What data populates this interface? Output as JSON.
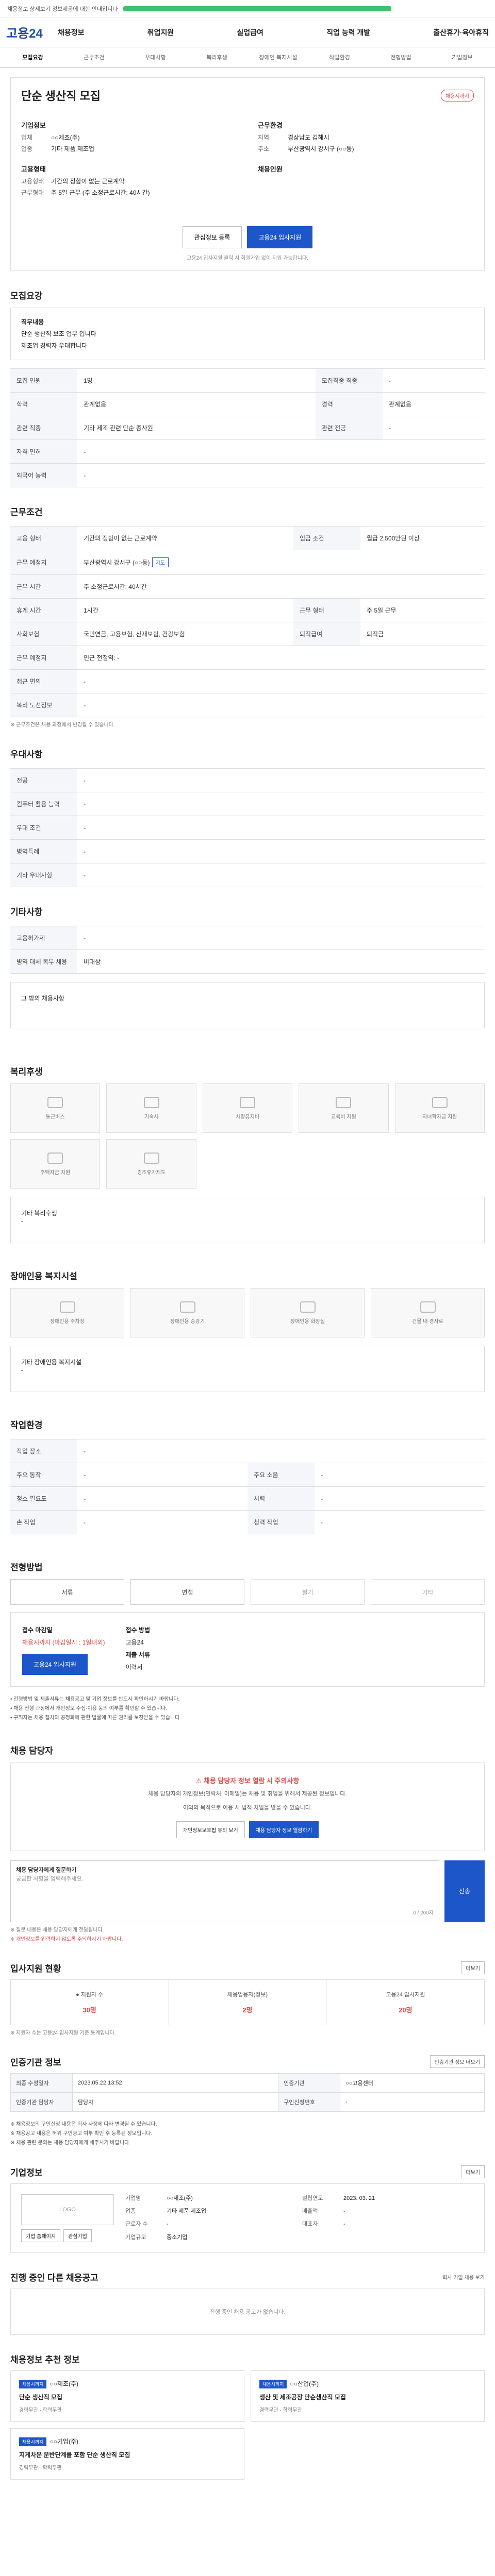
{
  "topbar": {
    "notice": "채용정보 상세보기 정보제공에 대한 안내입니다"
  },
  "gnb": {
    "logo": "고용24",
    "menu": [
      "채용정보",
      "취업지원",
      "실업급여",
      "직업 능력 개발",
      "출산휴가·육아휴직"
    ]
  },
  "anchor_tabs": [
    "모집요강",
    "근무조건",
    "우대사항",
    "복리후생",
    "장애인 복지시설",
    "작업환경",
    "전형방법",
    "기업정보"
  ],
  "job": {
    "title": "단순 생산직 모집",
    "badge": "채용시까지",
    "company_label": "기업정보",
    "company_name_k": "업체",
    "company_name_v": "○○제조(주)",
    "industry_k": "업종",
    "industry_v": "기타 제품 제조업",
    "workplace_label": "근무환경",
    "location_k": "지역",
    "location_v": "경상남도 김해시",
    "address_k": "주소",
    "address_v": "부산광역시 강서구 (○○동)",
    "type_label": "고용형태",
    "employ_k": "고용형태",
    "employ_v": "기간의 정함이 없는 근로계약",
    "hours_k": "근무형태",
    "hours_v": "주 5일 근무 (주 소정근로시간: 40시간)",
    "pay_label": "채용인원",
    "scrap_btn": "관심정보 등록",
    "apply_btn": "고용24 입사지원",
    "notice": "고용24 입사지원 클릭 시 회원가입 없이 지원 가능합니다."
  },
  "recruit": {
    "title": "모집요강",
    "duty_label": "직무내용",
    "duty_text": "단순 생산직 보조 업무 입니다",
    "duty_text2": "제조업 경력자 우대합니다",
    "rows": [
      {
        "k": "모집 인원",
        "v": "1명",
        "k2": "모집직종 직종",
        "v2": "-"
      },
      {
        "k": "학력",
        "v": "관계없음",
        "k2": "경력",
        "v2": "관계없음"
      },
      {
        "k": "관련 직종",
        "v": "기타 제조 관련 단순 종사원",
        "k2": "관련 전공",
        "v2": "-"
      },
      {
        "k": "자격 면허",
        "v": "-",
        "k2": "",
        "v2": ""
      },
      {
        "k": "외국어 능력",
        "v": "-",
        "k2": "",
        "v2": ""
      }
    ]
  },
  "work": {
    "title": "근무조건",
    "rows": [
      {
        "k": "고용 형태",
        "v": "기간의 정함이 없는 근로계약",
        "k2": "임금 조건",
        "v2": "월급 2,500만원 이상"
      },
      {
        "k": "근무 예정지",
        "v": "부산광역시 강서구 (○○동)",
        "k2": "",
        "v2": ""
      },
      {
        "k": "근무 시간",
        "v": "주 소정근로시간: 40시간",
        "k2": "",
        "v2": ""
      },
      {
        "k": "휴게 시간",
        "v": "1시간",
        "k2": "근무 형태",
        "v2": "주 5일 근무"
      },
      {
        "k": "사회보험",
        "v": "국민연금, 고용보험, 산재보험, 건강보험",
        "k2": "퇴직급여",
        "v2": "퇴직금"
      },
      {
        "k": "근무 예정지",
        "v": "인근 전철역: -",
        "k2": "",
        "v2": ""
      },
      {
        "k": "접근 편의",
        "v": "-",
        "k2": "",
        "v2": ""
      },
      {
        "k": "복리 노선정보",
        "v": "-",
        "k2": "",
        "v2": ""
      }
    ],
    "note": "※ 근무조건은 채용 과정에서 변경될 수 있습니다."
  },
  "prefer": {
    "title": "우대사항",
    "rows": [
      {
        "k": "전공",
        "v": "-"
      },
      {
        "k": "컴퓨터 활용 능력",
        "v": "-"
      },
      {
        "k": "우대 조건",
        "v": "-"
      },
      {
        "k": "병역특례",
        "v": "-"
      },
      {
        "k": "기타 우대사항",
        "v": "-"
      }
    ]
  },
  "etc": {
    "title": "기타사항",
    "rows": [
      {
        "k": "고용허가제",
        "v": "-"
      },
      {
        "k": "병역 대체 복무 채용",
        "v": "비대상"
      }
    ],
    "note_label": "그 밖의 채용사항"
  },
  "welfare": {
    "title": "복리후생",
    "icons": [
      "통근버스",
      "기숙사",
      "차량유지비",
      "교육비 지원",
      "자녀학자금 지원",
      "주택자금 지원",
      "경조휴가제도",
      "",
      "",
      ""
    ],
    "other_label": "기타 복리후생",
    "other_value": "-"
  },
  "facility": {
    "title": "장애인용 복지시설",
    "icons": [
      "장애인용 주차장",
      "장애인용 승강기",
      "장애인용 화장실",
      "건물 내 경사로"
    ],
    "other_label": "기타 장애인용 복지시설",
    "other_value": "-"
  },
  "env": {
    "title": "작업환경",
    "rows": [
      {
        "k": "작업 장소",
        "v": "-",
        "k2": "",
        "v2": ""
      },
      {
        "k": "주요 동작",
        "v": "-",
        "k2": "주요 소음",
        "v2": "-"
      },
      {
        "k": "청소 필요도",
        "v": "-",
        "k2": "시력",
        "v2": "-"
      },
      {
        "k": "손 작업",
        "v": "-",
        "k2": "청력 작업",
        "v2": "-"
      }
    ]
  },
  "method": {
    "title": "전형방법",
    "options": [
      "서류",
      "면접",
      "필기",
      "기타"
    ],
    "deadline_label": "접수 마감일",
    "deadline_value": "채용시까지 (마감일시 : 1일내외)",
    "apply_btn": "고용24 입사지원",
    "method_label": "접수 방법",
    "method_value": "고용24",
    "docs_label": "제출 서류",
    "docs_value": "이력서",
    "bullets": [
      "• 전형방법 및 제출서류는 채용공고 및 기업 정보를 반드시 확인하시기 바랍니다.",
      "• 채용 전형 과정에서 개인정보 수집·이용 동의 여부를 확인할 수 있습니다.",
      "• 구직자는 채용 절차의 공정화에 관한 법률에 따른 권리를 보장받을 수 있습니다."
    ]
  },
  "contact": {
    "title": "채용 담당자",
    "warn_title": "채용 담당자 정보 열람 시 주의사항",
    "warn_sub": "채용 담당자의 개인정보(연락처, 이메일)는 채용 및 취업을 위해서 제공된 정보입니다.",
    "warn_sub2": "이외의 목적으로 이용 시 법적 처벌을 받을 수 있습니다.",
    "btn1": "개인정보보호법 유의 보기",
    "btn2": "채용 담당자 정보 열람하기",
    "ask_label": "채용 담당자에게 질문하기",
    "ask_placeholder": "궁금한 사항을 입력해주세요.",
    "count": "0 / 200자",
    "send": "전송",
    "privacy1": "※ 질문 내용은 채용 담당자에게 전달됩니다.",
    "privacy2": "※ 개인정보를 입력하지 않도록 주의하시기 바랍니다."
  },
  "stats": {
    "title": "입사지원 현황",
    "link": "더보기",
    "items": [
      {
        "label": "● 지원자 수",
        "value": "30명"
      },
      {
        "label": "채용임용자(정보)",
        "value": "2명"
      },
      {
        "label": "고용24 입사지원",
        "value": "20명"
      }
    ],
    "note": "※ 지원자 수는 고용24 입사지원 기준 통계입니다."
  },
  "info": {
    "title": "인증기관 정보",
    "link": "인증기관 정보 더보기",
    "rows": [
      {
        "k": "최종 수정일자",
        "v": "2023.05.22 13:52",
        "k2": "인증기관",
        "v2": "○○고용센터"
      },
      {
        "k": "인증기관 담당자",
        "v": "담당자",
        "k2": "구인신청번호",
        "v2": "-"
      }
    ],
    "notes": [
      "※ 채용정보의 구인신청 내용은 회사 사정에 따라 변경될 수 있습니다.",
      "※ 채용공고 내용은 허위 구인광고 여부 확인 후 등록된 정보입니다.",
      "※ 채용 관련 문의는 채용 담당자에게 해주시기 바랍니다."
    ]
  },
  "corp": {
    "title": "기업정보",
    "link": "더보기",
    "logo_alt": "LOGO",
    "btn1": "기업 홈페이지",
    "btn2": "관심기업",
    "fields": [
      {
        "k": "기업명",
        "v": "○○제조(주)",
        "k2": "설립연도",
        "v2": "2023. 03. 21"
      },
      {
        "k": "업종",
        "v": "기타 제품 제조업",
        "k2": "매출액",
        "v2": "-"
      },
      {
        "k": "근로자 수",
        "v": "-",
        "k2": "대표자",
        "v2": "-"
      },
      {
        "k": "기업규모",
        "v": "중소기업",
        "k2": "",
        "v2": ""
      }
    ]
  },
  "other_jobs": {
    "title": "진행 중인 다른 채용공고",
    "link": "회사 기업 채용 보기",
    "empty": "진행 중인 채용 공고가 없습니다."
  },
  "recommend": {
    "title": "채용정보 추천 정보",
    "items": [
      {
        "tag": "채용시까지",
        "company": "○○제조(주)",
        "title": "단순 생산직 모집",
        "meta": "경력무관 · 학력무관"
      },
      {
        "tag": "채용시까지",
        "company": "○○산업(주)",
        "title": "생산 및 제조공장 단순생산직 모집",
        "meta": "경력무관 · 학력무관"
      },
      {
        "tag": "채용시까지",
        "company": "○○기업(주)",
        "title": "지게차운 운반단계를 포함 단순 생산직 모집",
        "meta": "경력무관 · 학력무관"
      }
    ]
  }
}
